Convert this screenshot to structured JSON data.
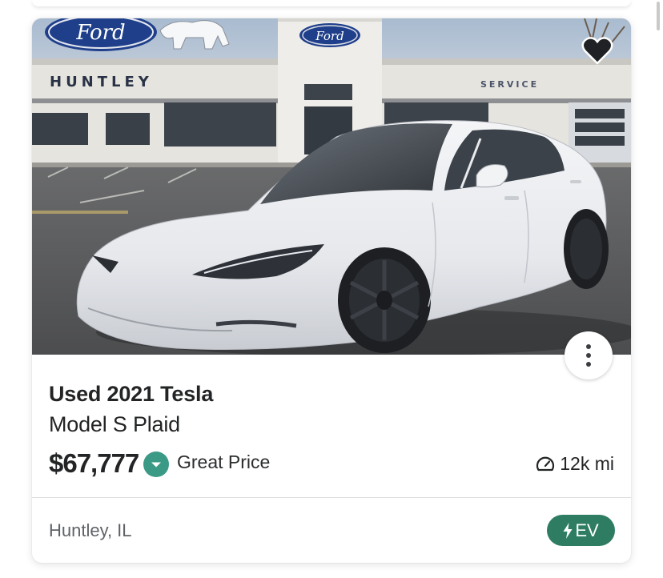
{
  "listing": {
    "photo_alt": "",
    "dealer_sign": "HUNTLEY",
    "service_sign": "SERVICE",
    "brand_logo_text": "Ford",
    "title_line1": "Used 2021 Tesla",
    "title_line2": "Model S Plaid",
    "price": "$67,777",
    "deal_rating": "Great Price",
    "deal_icon": "chevron-down-circle-icon",
    "mileage": "12k mi",
    "mileage_icon": "speedometer-icon",
    "location": "Huntley, IL",
    "badge_label": "EV",
    "badge_icon": "lightning-icon",
    "favorite_icon": "heart-icon",
    "more_icon": "vertical-dots-icon"
  },
  "colors": {
    "deal_green": "#3a9a86",
    "ev_badge_bg": "#2e7d62",
    "text_primary": "#222426",
    "text_secondary": "#5f6368"
  }
}
